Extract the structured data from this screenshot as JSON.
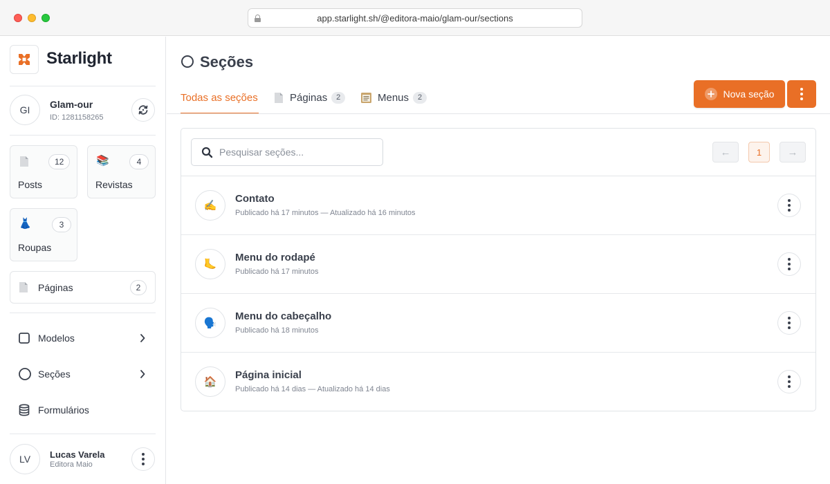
{
  "browser": {
    "url": "app.starlight.sh/@editora-maio/glam-our/sections"
  },
  "sidebar": {
    "brand": "Starlight",
    "workspace": {
      "initials": "GI",
      "name": "Glam-our",
      "id_label": "ID: 1281158265"
    },
    "collections": [
      {
        "label": "Posts",
        "count": "12",
        "icon": "page-icon"
      },
      {
        "label": "Revistas",
        "count": "4",
        "icon": "books-icon"
      },
      {
        "label": "Roupas",
        "count": "3",
        "icon": "dress-icon"
      }
    ],
    "pages": {
      "label": "Páginas",
      "count": "2",
      "icon": "page-icon"
    },
    "nav": [
      {
        "label": "Modelos",
        "icon": "square-icon"
      },
      {
        "label": "Seções",
        "icon": "circle-icon"
      },
      {
        "label": "Formulários",
        "icon": "database-icon"
      }
    ],
    "user": {
      "initials": "LV",
      "name": "Lucas Varela",
      "role": "Editora Maio"
    }
  },
  "main": {
    "title": "Seções",
    "tabs": [
      {
        "label": "Todas as seções",
        "active": true
      },
      {
        "label": "Páginas",
        "count": "2",
        "icon": "page-icon"
      },
      {
        "label": "Menus",
        "count": "2",
        "icon": "menu-icon"
      }
    ],
    "new_button": "Nova seção",
    "search": {
      "placeholder": "Pesquisar seções..."
    },
    "pagination": {
      "prev": "←",
      "page": "1",
      "next": "→"
    },
    "sections": [
      {
        "title": "Contato",
        "meta": "Publicado há 17 minutos — Atualizado há 16 minutos",
        "icon": "writing-hand-icon"
      },
      {
        "title": "Menu do rodapé",
        "meta": "Publicado há 17 minutos",
        "icon": "foot-icon"
      },
      {
        "title": "Menu do cabeçalho",
        "meta": "Publicado há 18 minutos",
        "icon": "speaking-head-icon"
      },
      {
        "title": "Página inicial",
        "meta": "Publicado há 14 dias — Atualizado há 14 dias",
        "icon": "house-icon"
      }
    ]
  },
  "colors": {
    "accent": "#e96f26",
    "text": "#3a404c",
    "muted": "#7f8591",
    "border": "#e3e5e8"
  }
}
